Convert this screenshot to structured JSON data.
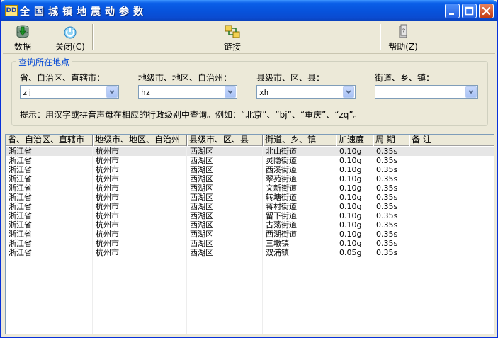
{
  "window": {
    "app_icon": "DD",
    "title": "全国城镇地震动参数"
  },
  "toolbar": {
    "data_label": "数据",
    "close_label": "关闭(C)",
    "link_label": "链接",
    "help_label": "帮助(Z)"
  },
  "query": {
    "group_title": "查询所在地点",
    "province_label": "省、自治区、直辖市：",
    "city_label": "地级市、地区、自治州：",
    "county_label": "县级市、区、县：",
    "street_label": "街道、乡、镇：",
    "province_value": "zj",
    "city_value": "hz",
    "county_value": "xh",
    "street_value": "",
    "hint": "提示：用汉字或拼音声母在相应的行政级别中查询。例如：“北京”、“bj”、“重庆”、“zq”。"
  },
  "table": {
    "headers": [
      "省、自治区、直辖市",
      "地级市、地区、自治州",
      "县级市、区、县",
      "街道、乡、镇",
      "加速度",
      "周 期",
      "备 注"
    ],
    "rows": [
      [
        "浙江省",
        "杭州市",
        "西湖区",
        "北山街道",
        "0.10g",
        "0.35s",
        ""
      ],
      [
        "浙江省",
        "杭州市",
        "西湖区",
        "灵隐街道",
        "0.10g",
        "0.35s",
        ""
      ],
      [
        "浙江省",
        "杭州市",
        "西湖区",
        "西溪街道",
        "0.10g",
        "0.35s",
        ""
      ],
      [
        "浙江省",
        "杭州市",
        "西湖区",
        "翠苑街道",
        "0.10g",
        "0.35s",
        ""
      ],
      [
        "浙江省",
        "杭州市",
        "西湖区",
        "文新街道",
        "0.10g",
        "0.35s",
        ""
      ],
      [
        "浙江省",
        "杭州市",
        "西湖区",
        "转塘街道",
        "0.10g",
        "0.35s",
        ""
      ],
      [
        "浙江省",
        "杭州市",
        "西湖区",
        "蒋村街道",
        "0.10g",
        "0.35s",
        ""
      ],
      [
        "浙江省",
        "杭州市",
        "西湖区",
        "留下街道",
        "0.10g",
        "0.35s",
        ""
      ],
      [
        "浙江省",
        "杭州市",
        "西湖区",
        "古荡街道",
        "0.10g",
        "0.35s",
        ""
      ],
      [
        "浙江省",
        "杭州市",
        "西湖区",
        "西湖街道",
        "0.10g",
        "0.35s",
        ""
      ],
      [
        "浙江省",
        "杭州市",
        "西湖区",
        "三墩镇",
        "0.10g",
        "0.35s",
        ""
      ],
      [
        "浙江省",
        "杭州市",
        "西湖区",
        "双浦镇",
        "0.05g",
        "0.35s",
        ""
      ]
    ]
  },
  "colors": {
    "titlebar": "#0752DB",
    "group_title": "#0046D5",
    "selected_row": "#E6E6E6"
  }
}
